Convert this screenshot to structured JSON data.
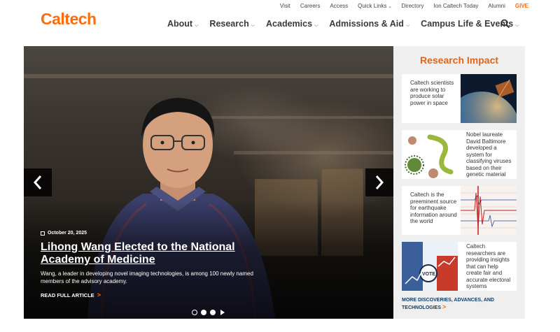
{
  "brand": {
    "logo": "Caltech",
    "accent": "#ff6c0c"
  },
  "utility_nav": [
    {
      "label": "Visit",
      "caret": false
    },
    {
      "label": "Careers",
      "caret": false
    },
    {
      "label": "Access",
      "caret": false
    },
    {
      "label": "Quick Links",
      "caret": true
    },
    {
      "label": "Directory",
      "caret": false
    },
    {
      "label": "Ion Caltech Today",
      "caret": false
    },
    {
      "label": "Alumni",
      "caret": false
    },
    {
      "label": "GIVE",
      "caret": false
    }
  ],
  "main_nav": [
    {
      "label": "About"
    },
    {
      "label": "Research"
    },
    {
      "label": "Academics"
    },
    {
      "label": "Admissions & Aid"
    },
    {
      "label": "Campus Life & Events"
    }
  ],
  "search": {
    "icon": "search-icon"
  },
  "hero": {
    "date": "October 20, 2025",
    "headline": "Lihong Wang Elected to the National Academy of Medicine",
    "summary": "Wang, a leader in developing novel imaging technologies, is among 100 newly named members of the advisory academy.",
    "read_more": "READ FULL ARTICLE",
    "read_more_chevron": ">",
    "slide_count": 3,
    "active_slide": 2
  },
  "research_impact": {
    "title": "Research Impact",
    "cards": [
      {
        "text": "Caltech scientists are working to produce solar power in space",
        "image": "solar-satellite-image"
      },
      {
        "text": "Nobel laureate David Baltimore developed a system for classifying viruses based on their genetic material",
        "image": "virus-illustration-image"
      },
      {
        "text": "Caltech is the preeminent source for earthquake information around the world",
        "image": "seismograph-image"
      },
      {
        "text": "Caltech researchers are providing insights that can help create fair and accurate electoral systems",
        "image": "vote-illustration-image"
      }
    ],
    "more": "MORE DISCOVERIES, ADVANCES, AND TECHNOLOGIES",
    "more_chevron": ">"
  }
}
